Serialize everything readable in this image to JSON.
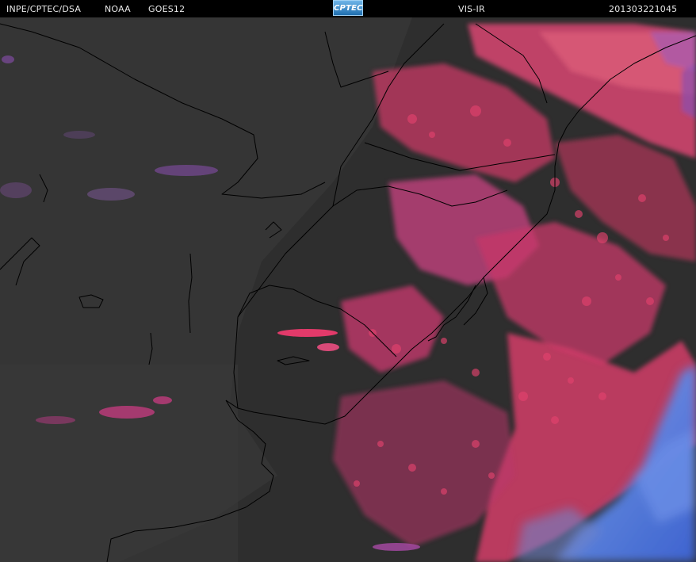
{
  "header": {
    "agency": "INPE/CPTEC/DSA",
    "provider": "NOAA",
    "satellite": "GOES12",
    "logo_text": "CPTEC",
    "channel": "VIS-IR",
    "timestamp": "201303221045"
  },
  "colors": {
    "background": "#2f2f2f",
    "cloud_primary": "#e23a6a",
    "cloud_secondary": "#b8377f",
    "cloud_cold": "#4f7ee0",
    "coastline": "#000000"
  }
}
